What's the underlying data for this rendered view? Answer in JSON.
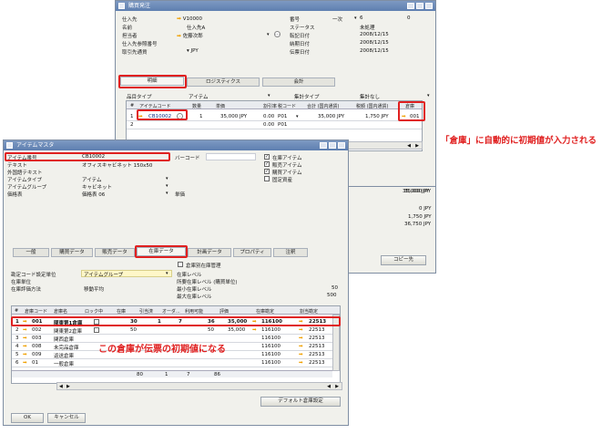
{
  "po_window": {
    "title": "購買発注",
    "header_left": [
      {
        "label": "仕入先",
        "value": "V10000",
        "arrow": true
      },
      {
        "label": "名前",
        "value": "仕入先A",
        "arrow": false
      },
      {
        "label": "担当者",
        "value": "佐藤次郎",
        "arrow": true
      },
      {
        "label": "仕入先参照番号",
        "value": "",
        "arrow": false
      },
      {
        "label": "取引先通貨",
        "value": "JPY",
        "arrow": false
      }
    ],
    "header_right": [
      {
        "label": "番号",
        "value": "一次",
        "value2": "6",
        "value3": "0"
      },
      {
        "label": "ステータス",
        "value": "未処理"
      },
      {
        "label": "転記日付",
        "value": "2008/12/15"
      },
      {
        "label": "納期日付",
        "value": "2008/12/15"
      },
      {
        "label": "伝票日付",
        "value": "2008/12/15"
      }
    ],
    "tabs": [
      "明細",
      "ロジスティクス",
      "会計"
    ],
    "item_type_label": "品目タイプ",
    "item_type_value": "アイテム",
    "summary_type_label": "集計タイプ",
    "summary_type_value": "集計なし",
    "grid_headers": [
      "#",
      "アイテムコード",
      "数量",
      "単価",
      "割引率",
      "税コード",
      "合計 (国内通貨)",
      "税額 (国内通貨)",
      "倉庫"
    ],
    "grid_rows": [
      {
        "num": "1",
        "item": "CB10002",
        "qty": "1",
        "price": "35,000 JPY",
        "disc": "0.00",
        "tax": "P01",
        "total": "35,000 JPY",
        "taxamt": "1,750 JPY",
        "wh": "001"
      },
      {
        "num": "2",
        "item": "",
        "qty": "",
        "price": "",
        "disc": "0.00",
        "tax": "P01",
        "total": "",
        "taxamt": "",
        "wh": ""
      }
    ],
    "totals": [
      "35,000 JPY",
      "0 JPY",
      "1,750 JPY",
      "36,750 JPY"
    ],
    "copy_button": "コピー先"
  },
  "item_window": {
    "title": "アイテムマスタ",
    "fields_left": [
      {
        "label": "アイテム番号",
        "value": "CB10002"
      },
      {
        "label": "テキスト",
        "value": "オフィスキャビネット 150x50"
      },
      {
        "label": "外国語テキスト",
        "value": ""
      },
      {
        "label": "アイテムタイプ",
        "value": "アイテム"
      },
      {
        "label": "アイテムグループ",
        "value": "キャビネット"
      },
      {
        "label": "価格表",
        "value": "価格表 06"
      }
    ],
    "barcode_label": "バーコード",
    "unit_price_label": "単価",
    "checkboxes": [
      {
        "label": "在庫アイテム",
        "checked": true
      },
      {
        "label": "販売アイテム",
        "checked": true
      },
      {
        "label": "購買アイテム",
        "checked": true
      },
      {
        "label": "固定資産",
        "checked": false
      }
    ],
    "tabs": [
      "一般",
      "購買データ",
      "販売データ",
      "在庫データ",
      "計画データ",
      "プロパティ",
      "注釈"
    ],
    "manage_by_wh_label": "倉庫別在庫管理",
    "settings_left": [
      {
        "label": "勘定コード設定単位",
        "value": "アイテムグループ"
      },
      {
        "label": "在庫単位",
        "value": ""
      },
      {
        "label": "在庫評価方法",
        "value": "移動平均"
      }
    ],
    "settings_right": [
      {
        "label": "在庫レベル",
        "value": ""
      },
      {
        "label": "所要在庫レベル (購買単位)",
        "value": ""
      },
      {
        "label": "最小在庫レベル",
        "value": "50"
      },
      {
        "label": "最大在庫レベル",
        "value": "500"
      }
    ],
    "wh_headers": [
      "#",
      "倉庫コード",
      "倉庫名",
      "ロック中",
      "在庫",
      "引当済",
      "オーダ...",
      "利用可能",
      "評価",
      "在庫勘定",
      "割当勘定"
    ],
    "wh_rows": [
      {
        "num": "1",
        "code": "001",
        "name": "関東第1倉庫",
        "stock": "30",
        "committed": "1",
        "ordered": "7",
        "available": "36",
        "value": "35,000",
        "acct": "116100",
        "acct2": "22513"
      },
      {
        "num": "2",
        "code": "002",
        "name": "関東第2倉庫",
        "stock": "50",
        "committed": "",
        "ordered": "",
        "available": "50",
        "value": "35,000",
        "acct": "116100",
        "acct2": "22513"
      },
      {
        "num": "3",
        "code": "003",
        "name": "関西倉庫",
        "stock": "",
        "committed": "",
        "ordered": "",
        "available": "",
        "value": "",
        "acct": "116100",
        "acct2": "22513"
      },
      {
        "num": "4",
        "code": "008",
        "name": "未完品倉庫",
        "stock": "",
        "committed": "",
        "ordered": "",
        "available": "",
        "value": "",
        "acct": "116100",
        "acct2": "22513"
      },
      {
        "num": "5",
        "code": "009",
        "name": "返送倉庫",
        "stock": "",
        "committed": "",
        "ordered": "",
        "available": "",
        "value": "",
        "acct": "116100",
        "acct2": "22513"
      },
      {
        "num": "6",
        "code": "01",
        "name": "一般倉庫",
        "stock": "",
        "committed": "",
        "ordered": "",
        "available": "",
        "value": "",
        "acct": "116100",
        "acct2": "22513"
      }
    ],
    "wh_totals": {
      "stock": "80",
      "committed": "1",
      "ordered": "7",
      "available": "86"
    },
    "default_wh_button": "デフォルト倉庫設定",
    "ok_button": "OK",
    "cancel_button": "キャンセル"
  },
  "annotations": {
    "top": "「倉庫」に自動的に初期値が入力される",
    "bottom": "この倉庫が伝票の初期値になる"
  },
  "colors": {
    "annotation_red": "#e02020",
    "titlebar_blue": "#6684b5",
    "link_arrow": "#f0a000"
  }
}
